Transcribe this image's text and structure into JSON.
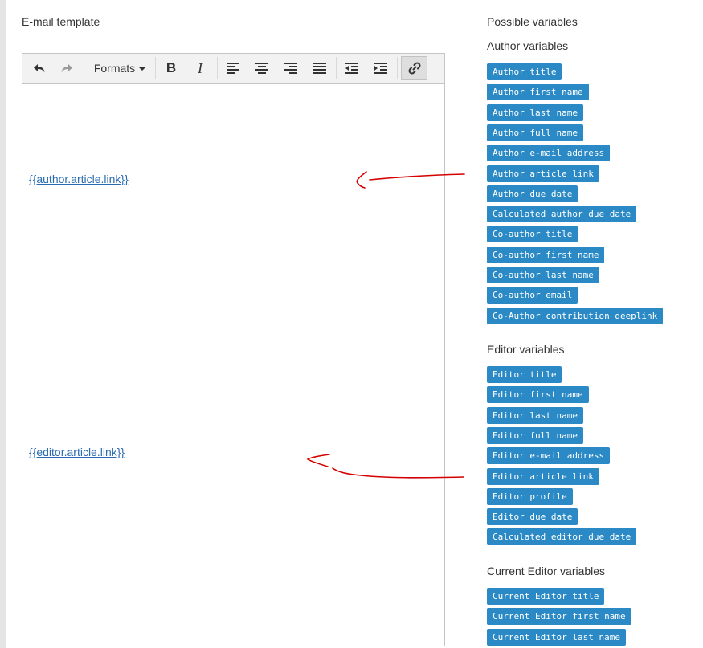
{
  "email_template": {
    "title": "E-mail template",
    "toolbar": {
      "undo": "undo-icon",
      "redo": "redo-icon",
      "formats_label": "Formats",
      "bold": "B",
      "italic": "I"
    },
    "content": {
      "author_link": "{{author.article.link}}",
      "editor_link": "{{editor.article.link}}"
    }
  },
  "variables": {
    "title": "Possible variables",
    "author": {
      "heading": "Author variables",
      "items": [
        "Author title",
        "Author first name",
        "Author last name",
        "Author full name",
        "Author e-mail address",
        "Author article link",
        "Author due date",
        "Calculated author due date",
        "Co-author title",
        "Co-author first name",
        "Co-author last name",
        "Co-author email",
        "Co-Author contribution deeplink"
      ]
    },
    "editor": {
      "heading": "Editor variables",
      "items": [
        "Editor title",
        "Editor first name",
        "Editor last name",
        "Editor full name",
        "Editor e-mail address",
        "Editor article link",
        "Editor profile",
        "Editor due date",
        "Calculated editor due date"
      ]
    },
    "current_editor": {
      "heading": "Current Editor variables",
      "items": [
        "Current Editor title",
        "Current Editor first name",
        "Current Editor last name"
      ]
    }
  },
  "colors": {
    "tag_bg": "#2b8ac6",
    "link": "#2b6cb0",
    "annotation": "#d40000"
  }
}
